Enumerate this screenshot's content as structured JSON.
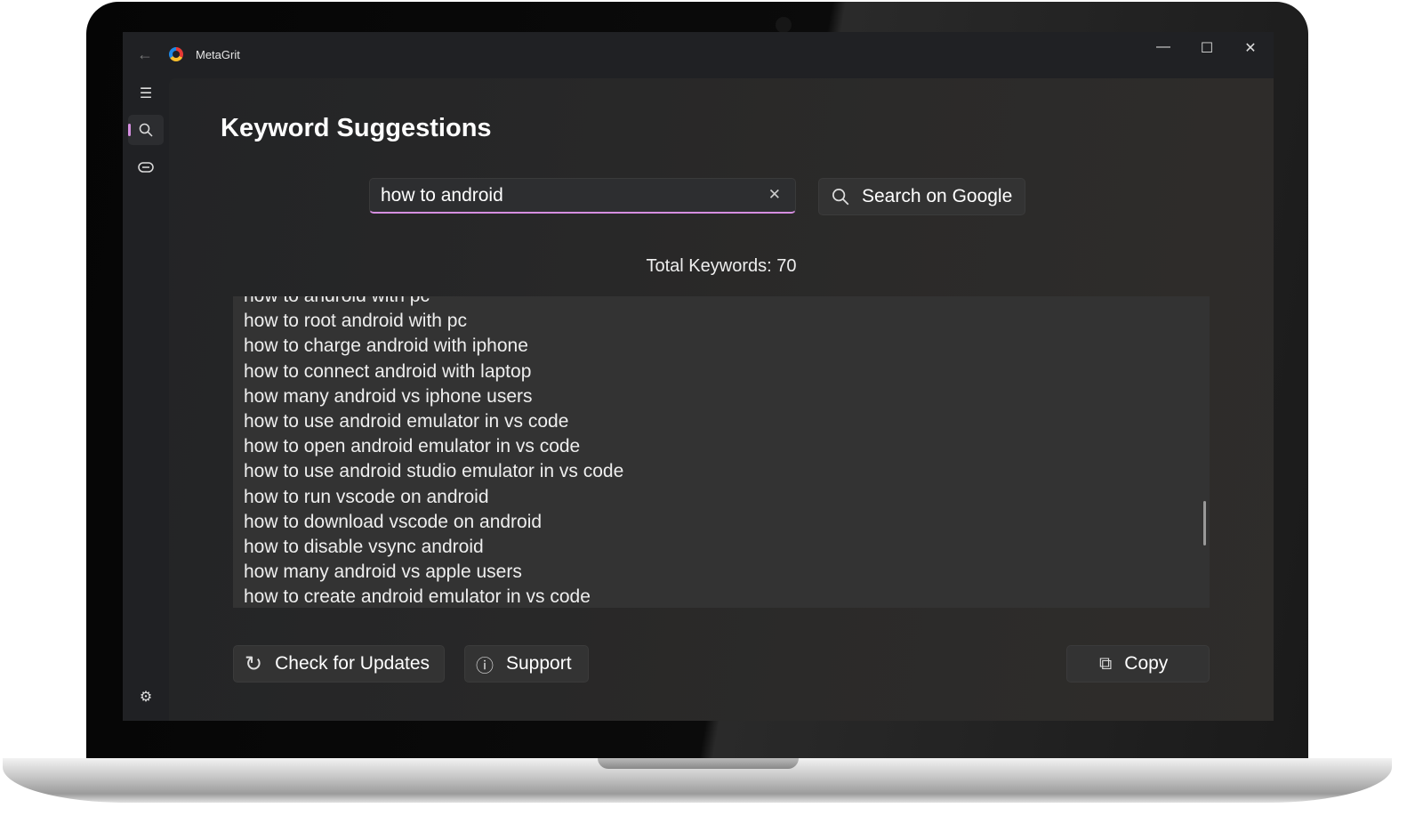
{
  "window": {
    "title": "MetaGrit",
    "back": "←",
    "minimize": "—",
    "maximize": "☐",
    "close": "✕"
  },
  "sidebar": {
    "items": [
      {
        "name": "menu",
        "glyph": "☰"
      },
      {
        "name": "search",
        "glyph": "🔍︎",
        "active": true
      },
      {
        "name": "link",
        "glyph": "⊖"
      },
      {
        "name": "settings",
        "glyph": "⚙"
      }
    ]
  },
  "page": {
    "title": "Keyword Suggestions"
  },
  "search": {
    "value": "how to android",
    "clear": "✕",
    "button_label": "Search on Google",
    "button_icon": "search-icon"
  },
  "total": "Total Keywords: 70",
  "keywords": [
    "how to android with pc",
    "how to root android with pc",
    "how to charge android with iphone",
    "how to connect android with laptop",
    "how many android vs iphone users",
    "how to use android emulator in vs code",
    "how to open android emulator in vs code",
    "how to use android studio emulator in vs code",
    "how to run vscode on android",
    "how to download vscode on android",
    "how to disable vsync android",
    "how many android vs apple users",
    "how to create android emulator in vs code"
  ],
  "footer": {
    "check_updates": "Check for Updates",
    "support": "Support",
    "copy": "Copy"
  },
  "colors": {
    "accent": "#d58ee0",
    "background": "#202124"
  }
}
